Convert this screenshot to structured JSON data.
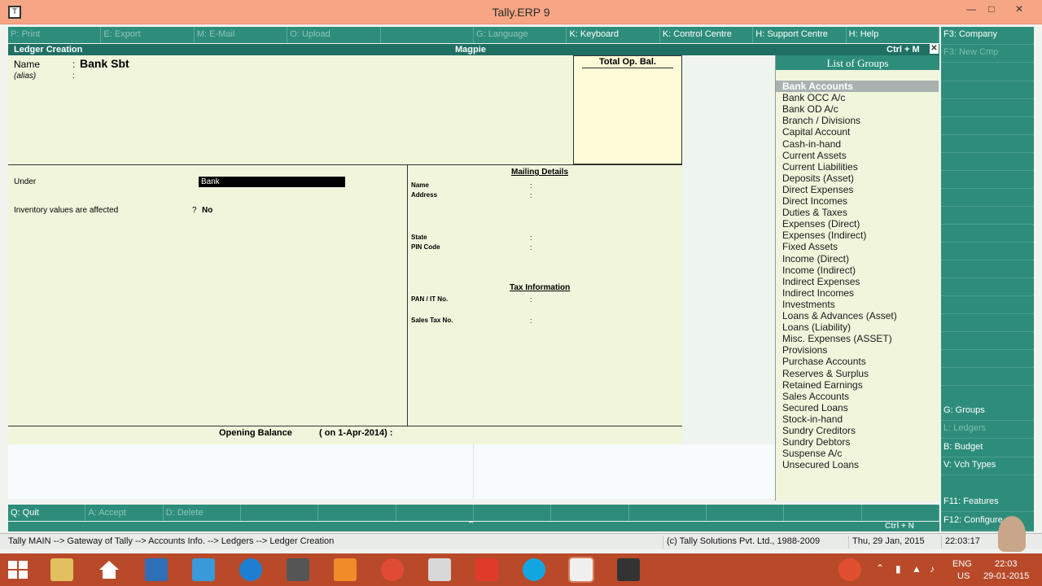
{
  "window": {
    "title": "Tally.ERP 9"
  },
  "top_buttons": [
    {
      "key": "P",
      "label": ": Print",
      "enabled": false
    },
    {
      "key": "E",
      "label": ": Export",
      "enabled": false
    },
    {
      "key": "M",
      "label": ": E-Mail",
      "enabled": false
    },
    {
      "key": "O",
      "label": ": Upload",
      "enabled": false
    },
    {
      "key": "",
      "label": "",
      "enabled": false
    },
    {
      "key": "G",
      "label": ": Language",
      "enabled": false
    },
    {
      "key": "K",
      "label": ": Keyboard",
      "enabled": true
    },
    {
      "key": "K",
      "label": ": Control Centre",
      "enabled": true
    },
    {
      "key": "H",
      "label": ": Support Centre",
      "enabled": true
    },
    {
      "key": "H",
      "label": ": Help",
      "enabled": true
    }
  ],
  "right_buttons": [
    {
      "label": "F3: Company",
      "enabled": true
    },
    {
      "label": "F3: New Cmp",
      "enabled": false
    },
    {
      "label": "G: Groups",
      "enabled": true
    },
    {
      "label": "L: Ledgers",
      "enabled": false
    },
    {
      "label": "B: Budget",
      "enabled": true
    },
    {
      "label": "V: Vch Types",
      "enabled": true
    },
    {
      "label": "F11: Features",
      "enabled": true
    },
    {
      "label": "F12: Configure",
      "enabled": true
    }
  ],
  "header": {
    "screen": "Ledger Creation",
    "company": "Magpie",
    "shortcut": "Ctrl + M",
    "close": "✕"
  },
  "form": {
    "name_label": "Name",
    "name_value": "Bank Sbt",
    "alias_label": "(alias)",
    "colon": ":",
    "under_label": "Under",
    "under_value": "Bank",
    "inventory_label": "Inventory values are affected",
    "inventory_q": "?",
    "inventory_value": "No",
    "total_op_bal": "Total Op. Bal.",
    "opening_balance_label": "Opening Balance",
    "opening_balance_date": "( on 1-Apr-2014)  :"
  },
  "mailing": {
    "title": "Mailing Details",
    "name_label": "Name",
    "address_label": "Address",
    "state_label": "State",
    "pin_label": "PIN Code"
  },
  "tax": {
    "title": "Tax Information",
    "pan_label": "PAN / IT No.",
    "sales_tax_label": "Sales Tax No."
  },
  "groups_panel": {
    "title": "List of Groups",
    "selected_index": 0,
    "items": [
      "Bank Accounts",
      "Bank OCC A/c",
      "Bank OD A/c",
      "Branch / Divisions",
      "Capital Account",
      "Cash-in-hand",
      "Current Assets",
      "Current Liabilities",
      "Deposits (Asset)",
      "Direct Expenses",
      "Direct Incomes",
      "Duties & Taxes",
      "Expenses (Direct)",
      "Expenses (Indirect)",
      "Fixed Assets",
      "Income (Direct)",
      "Income (Indirect)",
      "Indirect Expenses",
      "Indirect Incomes",
      "Investments",
      "Loans & Advances (Asset)",
      "Loans (Liability)",
      "Misc. Expenses (ASSET)",
      "Provisions",
      "Purchase Accounts",
      "Reserves & Surplus",
      "Retained Earnings",
      "Sales Accounts",
      "Secured Loans",
      "Stock-in-hand",
      "Sundry Creditors",
      "Sundry Debtors",
      "Suspense A/c",
      "Unsecured Loans"
    ]
  },
  "bottom_buttons": [
    {
      "label": "Q: Quit",
      "enabled": true
    },
    {
      "label": "A: Accept",
      "enabled": false
    },
    {
      "label": "D: Delete",
      "enabled": false
    },
    {
      "label": "",
      "enabled": false
    },
    {
      "label": "",
      "enabled": false
    },
    {
      "label": "",
      "enabled": false
    },
    {
      "label": "",
      "enabled": false
    },
    {
      "label": "",
      "enabled": false
    },
    {
      "label": "",
      "enabled": false
    },
    {
      "label": "",
      "enabled": false
    },
    {
      "label": "",
      "enabled": false
    },
    {
      "label": "",
      "enabled": false
    }
  ],
  "ctrl_n": "Ctrl + N",
  "status": {
    "breadcrumb": "Tally MAIN --> Gateway of Tally --> Accounts Info. --> Ledgers --> Ledger Creation",
    "copyright": "(c) Tally Solutions Pvt. Ltd., 1988-2009",
    "date": "Thu, 29 Jan, 2015",
    "time": "22:03:17"
  },
  "taskbar": {
    "lang": "ENG",
    "region": "US",
    "clock_time": "22:03",
    "clock_date": "29-01-2015"
  },
  "colors": {
    "tally_green": "#2d8d7a",
    "form_bg": "#f1f5dc",
    "title_bar": "#f6a685",
    "taskbar": "#b84a2a"
  }
}
